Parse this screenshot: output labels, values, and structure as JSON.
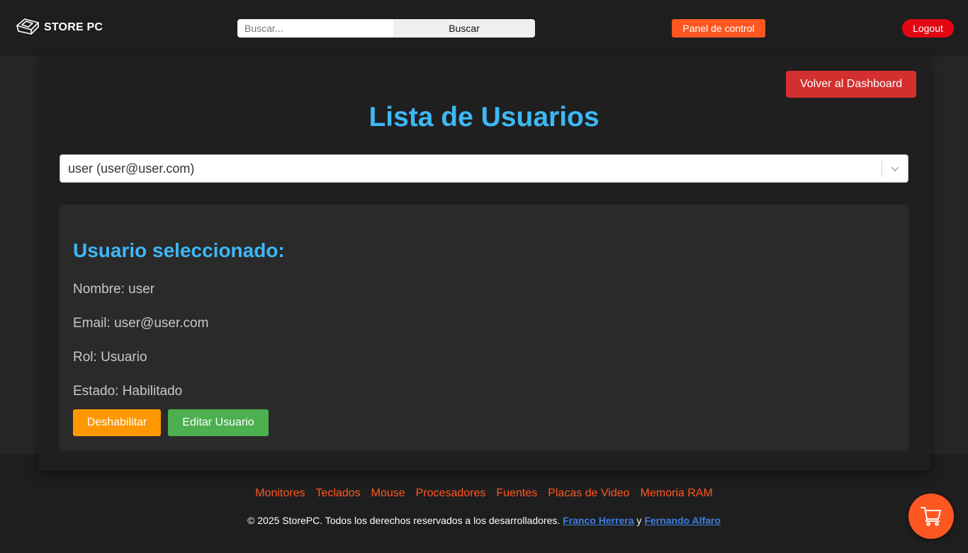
{
  "header": {
    "brand": "STORE PC",
    "search_placeholder": "Buscar...",
    "search_button": "Buscar",
    "panel_button": "Panel de control",
    "logout_button": "Logout"
  },
  "main": {
    "back_button": "Volver al Dashboard",
    "title": "Lista de Usuarios",
    "user_select": {
      "selected": "user (user@user.com)"
    },
    "details": {
      "heading": "Usuario seleccionado:",
      "name": "Nombre: user",
      "email": "Email: user@user.com",
      "role": "Rol: Usuario",
      "status": "Estado: Habilitado",
      "disable_button": "Deshabilitar",
      "edit_button": "Editar Usuario"
    }
  },
  "footer": {
    "links": [
      "Monitores",
      "Teclados",
      "Mouse",
      "Procesadores",
      "Fuentes",
      "Placas de Video",
      "Memoria RAM"
    ],
    "copyright_prefix": "© 2025 StorePC. Todos los derechos reservados a los desarrolladores.",
    "dev1": "Franco Herrera",
    "connector": "y",
    "dev2": "Fernando Alfaro"
  },
  "icons": {
    "brand": "keyboard-key-icon",
    "select_arrow": "chevron-down-icon",
    "cart": "shopping-cart-icon"
  },
  "colors": {
    "accent_orange": "#ff5722",
    "title_blue": "#3db8f5",
    "logout_red": "#e30613",
    "back_red": "#d32f2f",
    "disable_orange": "#ff9800",
    "edit_green": "#4caf50"
  }
}
